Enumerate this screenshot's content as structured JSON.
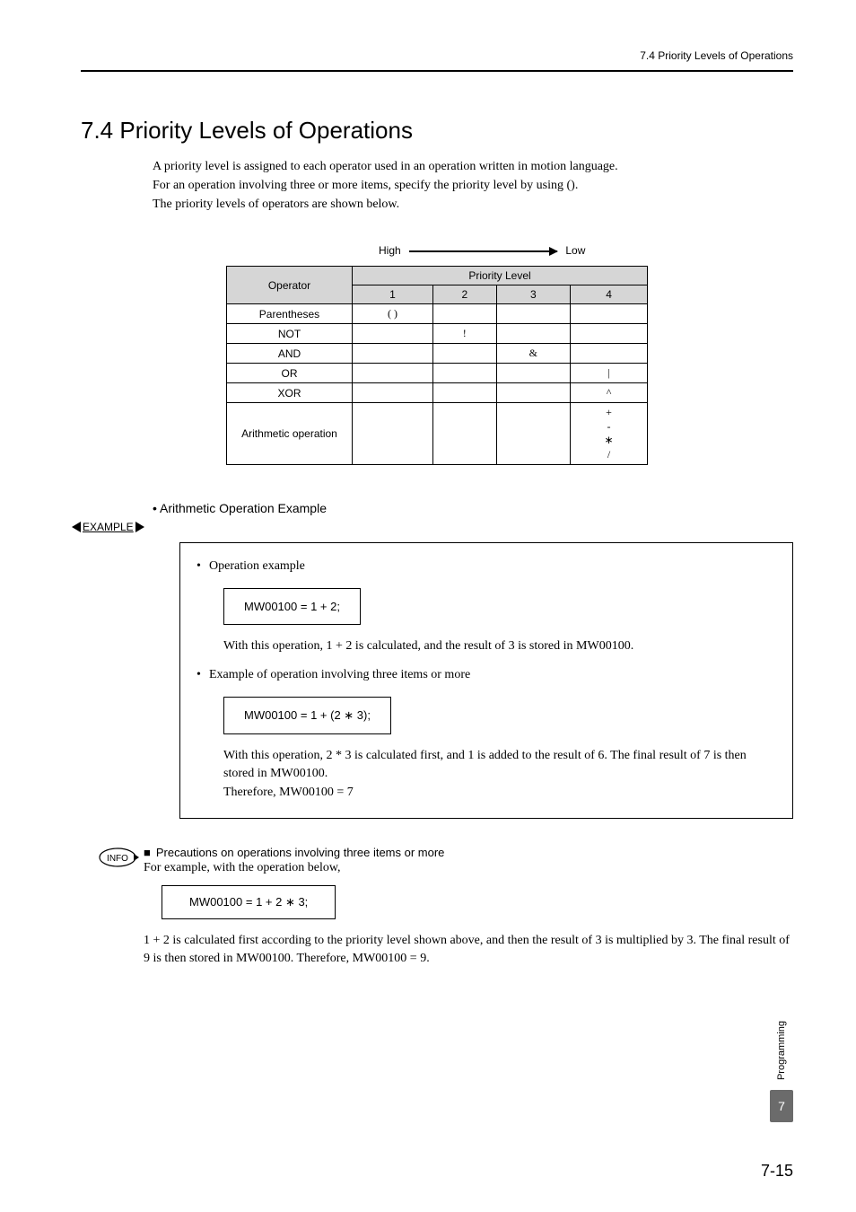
{
  "header": {
    "right": "7.4  Priority Levels of Operations"
  },
  "section": {
    "title": "7.4  Priority Levels of Operations"
  },
  "intro": {
    "p1": "A priority level is assigned to each operator used in an operation written in motion language.",
    "p2": "For an operation involving three or more items, specify the priority level by using ().",
    "p3": "The priority levels of operators are shown below."
  },
  "arrow": {
    "left": "High",
    "right": "Low"
  },
  "table": {
    "header_operator": "Operator",
    "header_plevel": "Priority Level",
    "col1": "1",
    "col2": "2",
    "col3": "3",
    "col4": "4",
    "rows": [
      {
        "op": "Parentheses",
        "c1": "( )",
        "c2": "",
        "c3": "",
        "c4": ""
      },
      {
        "op": "NOT",
        "c1": "",
        "c2": "!",
        "c3": "",
        "c4": ""
      },
      {
        "op": "AND",
        "c1": "",
        "c2": "",
        "c3": "&",
        "c4": ""
      },
      {
        "op": "OR",
        "c1": "",
        "c2": "",
        "c3": "",
        "c4": "|"
      },
      {
        "op": "XOR",
        "c1": "",
        "c2": "",
        "c3": "",
        "c4": "^"
      }
    ],
    "arith_label": "Arithmetic operation",
    "arith_ops": "+\n-\n∗\n/"
  },
  "ex": {
    "heading": "• Arithmetic Operation Example",
    "badge": "EXAMPLE",
    "b1": "Operation example",
    "code1": "MW00100 = 1 + 2;",
    "t1": "With this operation, 1 + 2 is calculated, and the result of 3 is stored in MW00100.",
    "b2": "Example of operation involving three items or more",
    "code2": "MW00100 = 1 +  (2 ∗ 3);",
    "t2a": "With this operation, 2 * 3 is calculated first, and 1 is added to the result of 6. The final result of 7 is then stored in MW00100.",
    "t2b": "Therefore, MW00100 = 7"
  },
  "info": {
    "icon_label": "INFO",
    "title": "Precautions on operations involving three items or more",
    "lead": "For example, with the operation below,",
    "code": "MW00100 = 1 + 2 ∗ 3;",
    "body": "1 + 2 is calculated first according to the priority level shown above, and then the result of 3 is multiplied by 3. The final result of 9 is then stored in MW00100. Therefore, MW00100 = 9."
  },
  "side": {
    "label": "Programming",
    "num": "7"
  },
  "page": {
    "num": "7-15"
  }
}
